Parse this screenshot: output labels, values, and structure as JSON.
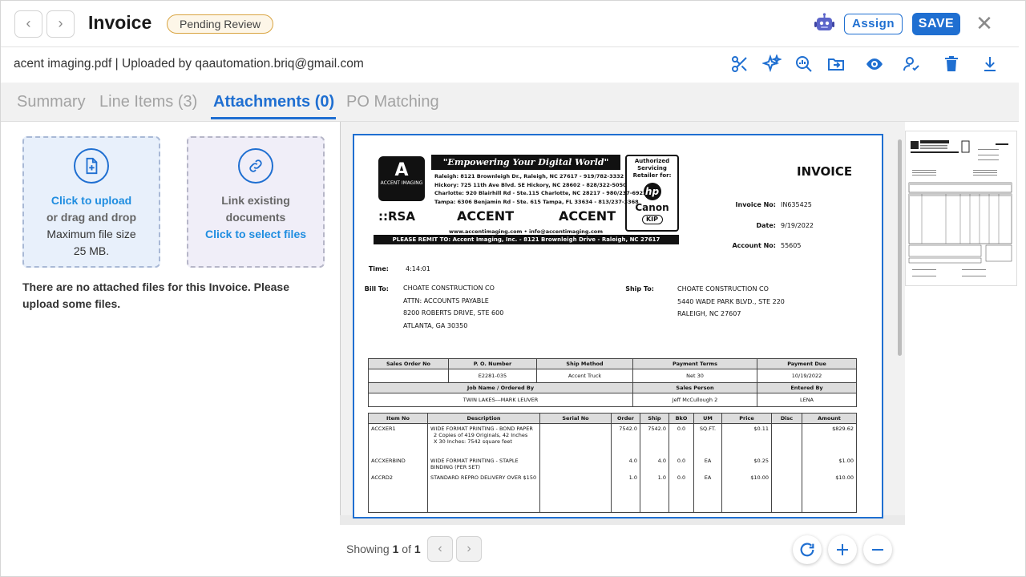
{
  "header": {
    "title": "Invoice",
    "status": "Pending Review",
    "assign_label": "Assign",
    "save_label": "SAVE",
    "close_glyph": "✕",
    "prev_glyph": "‹",
    "next_glyph": "›"
  },
  "filebar": {
    "file_info": "acent imaging.pdf | Uploaded by qaautomation.briq@gmail.com"
  },
  "tabs": [
    {
      "label": "Summary"
    },
    {
      "label": "Line Items (3)"
    },
    {
      "label": "Attachments (0)"
    },
    {
      "label": "PO Matching"
    }
  ],
  "upload": {
    "line1": "Click to upload",
    "line2": "or drag and drop",
    "line3": "Maximum file size",
    "line4": "25 MB."
  },
  "link": {
    "line1": "Link existing",
    "line2": "documents",
    "line3": "Click to select files"
  },
  "empty_message": "There are no attached files for this Invoice. Please upload some files.",
  "pagination": {
    "prefix": "Showing",
    "current": "1",
    "of": "of",
    "total": "1"
  },
  "colors": {
    "accent": "#1f6fd1",
    "badge_border": "#d9a441"
  },
  "document": {
    "slogan": "\"Empowering Your Digital World\"",
    "logo_text": "ACCENT IMAGING",
    "branches": [
      "Raleigh: 8121 Brownleigh Dr., Raleigh, NC 27617 - 919/782-3332",
      "Hickory: 725 11th Ave Blvd. SE  Hickory, NC 28602 - 828/322-5050",
      "Charlotte: 920 Blairhill Rd - Ste.115  Charlotte, NC 28217 - 980/237-6922",
      "Tampa: 6306 Benjamin Rd - Ste. 615 Tampa, FL 33634 - 813/237-3368"
    ],
    "rsa": "::RSA",
    "accent1": "ACCENT",
    "accent2": "ACCENT",
    "web": "www.accentimaging.com  •  info@accentimaging.com",
    "remit": "PLEASE REMIT TO:  Accent Imaging, Inc. - 8121 Brownleigh Drive - Raleigh, NC 27617",
    "auth_line1": "Authorized",
    "auth_line2": "Servicing",
    "auth_line3": "Retailer for:",
    "brand1": "hp",
    "brand2": "Canon",
    "brand3": "KIP",
    "invoice_title": "INVOICE",
    "invoice_no_label": "Invoice No:",
    "invoice_no": "IN635425",
    "date_label": "Date:",
    "date": "9/19/2022",
    "account_label": "Account No:",
    "account": "55605",
    "time_label": "Time:",
    "time": "4:14:01",
    "bill_to_label": "Bill To:",
    "bill_to": [
      "CHOATE CONSTRUCTION CO",
      "ATTN: ACCOUNTS PAYABLE",
      "8200 ROBERTS DRIVE, STE 600",
      "ATLANTA, GA  30350"
    ],
    "ship_to_label": "Ship To:",
    "ship_to": [
      "CHOATE CONSTRUCTION CO",
      "5440 WADE PARK BLVD., STE 220",
      "RALEIGH, NC  27607"
    ],
    "order_headers": [
      "Sales Order No",
      "P. O. Number",
      "Ship Method",
      "Payment Terms",
      "Payment Due"
    ],
    "order_values": [
      "",
      "E2281-035",
      "Accent Truck",
      "Net 30",
      "10/19/2022"
    ],
    "job_header": "Job Name / Ordered By",
    "sales_header": "Sales Person",
    "entered_header": "Entered By",
    "job_value": "TWIN LAKES---MARK LEUVER",
    "sales_value": "Jeff McCullough 2",
    "entered_value": "LENA",
    "item_headers": [
      "Item No",
      "Description",
      "Serial No",
      "Order",
      "Ship",
      "BkO",
      "UM",
      "Price",
      "Disc",
      "Amount"
    ],
    "items": [
      {
        "item": "ACCXER1",
        "desc": "WIDE FORMAT PRINTING - BOND PAPER",
        "sub1": "2 Copies of 419 Originals, 42 Inches",
        "sub2": "X 30 Inches: 7542 square feet",
        "order": "7542.0",
        "ship": "7542.0",
        "bko": "0.0",
        "um": "SQ.FT.",
        "price": "$0.11",
        "amount": "$829.62"
      },
      {
        "item": "ACCXERBIND",
        "desc": "WIDE FORMAT PRINTING - STAPLE BINDING (PER SET)",
        "sub1": "",
        "sub2": "",
        "order": "4.0",
        "ship": "4.0",
        "bko": "0.0",
        "um": "EA",
        "price": "$0.25",
        "amount": "$1.00"
      },
      {
        "item": "ACCRD2",
        "desc": "STANDARD REPRO DELIVERY OVER $150",
        "sub1": "",
        "sub2": "",
        "order": "1.0",
        "ship": "1.0",
        "bko": "0.0",
        "um": "EA",
        "price": "$10.00",
        "amount": "$10.00"
      }
    ]
  }
}
